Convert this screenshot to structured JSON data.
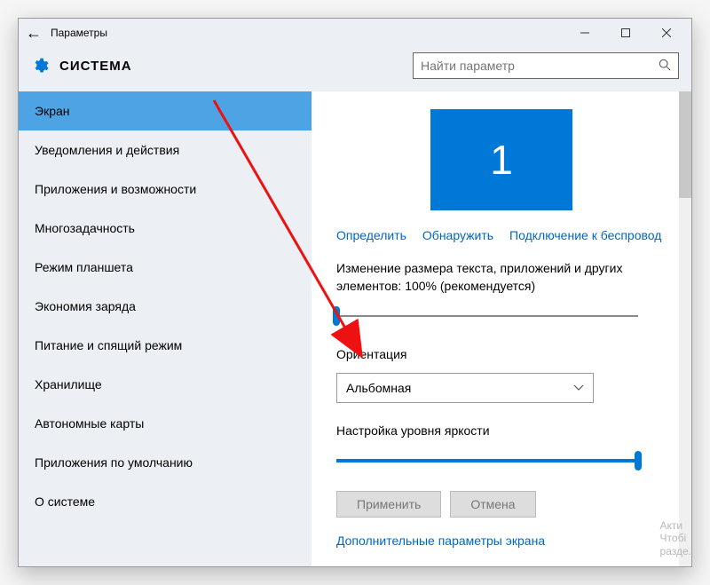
{
  "titlebar": {
    "title": "Параметры"
  },
  "header": {
    "section": "СИСТЕМА"
  },
  "search": {
    "placeholder": "Найти параметр"
  },
  "sidebar": {
    "items": [
      "Экран",
      "Уведомления и действия",
      "Приложения и возможности",
      "Многозадачность",
      "Режим планшета",
      "Экономия заряда",
      "Питание и спящий режим",
      "Хранилище",
      "Автономные карты",
      "Приложения по умолчанию",
      "О системе"
    ],
    "active_index": 0
  },
  "display": {
    "monitor_number": "1",
    "links": {
      "detect": "Определить",
      "identify": "Обнаружить",
      "wireless": "Подключение к беспровод"
    },
    "scale_label": "Изменение размера текста, приложений и других элементов: 100% (рекомендуется)",
    "scale_percent": 0,
    "orientation_label": "Ориентация",
    "orientation_value": "Альбомная",
    "brightness_label": "Настройка уровня яркости",
    "brightness_percent": 100,
    "apply": "Применить",
    "cancel": "Отмена",
    "more": "Дополнительные параметры экрана"
  },
  "colors": {
    "accent": "#0078d7",
    "link": "#0067c0"
  },
  "watermark": {
    "line1": "Акти",
    "line2": "Чтобі",
    "line3": "разде."
  }
}
